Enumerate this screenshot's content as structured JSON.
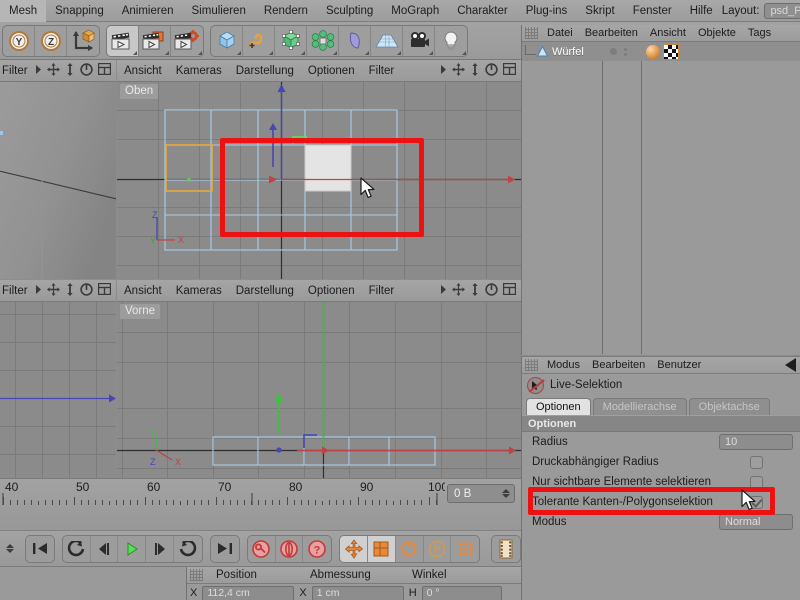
{
  "menubar": {
    "items": [
      "Mesh",
      "Snapping",
      "Animieren",
      "Simulieren",
      "Rendern",
      "Sculpting",
      "MoGraph",
      "Charakter",
      "Plug-ins",
      "Skript",
      "Fenster",
      "Hilfe"
    ],
    "layout_label": "Layout:",
    "layout_value": "psd_P"
  },
  "toolbar": {
    "groups": [
      {
        "name": "axis-group",
        "buttons": [
          {
            "icon": "axis-y-lock-icon",
            "label": "Y"
          },
          {
            "icon": "axis-z-lock-icon",
            "label": "Z"
          },
          {
            "icon": "world-object-axis-icon",
            "label": ""
          }
        ]
      },
      {
        "name": "render-group",
        "buttons": [
          {
            "icon": "render-view-icon",
            "label": ""
          },
          {
            "icon": "render-region-icon",
            "label": ""
          },
          {
            "icon": "render-settings-icon",
            "label": ""
          }
        ]
      },
      {
        "name": "object-group",
        "buttons": [
          {
            "icon": "cube-primitive-icon",
            "label": ""
          },
          {
            "icon": "spline-pen-icon",
            "label": ""
          },
          {
            "icon": "generator-nurbs-icon",
            "label": ""
          },
          {
            "icon": "mograph-array-icon",
            "label": ""
          },
          {
            "icon": "deformer-bend-icon",
            "label": ""
          },
          {
            "icon": "scene-floor-icon",
            "label": ""
          },
          {
            "icon": "camera-icon",
            "label": ""
          },
          {
            "icon": "light-bulb-icon",
            "label": ""
          }
        ]
      }
    ]
  },
  "objectmanager": {
    "menu": [
      "Datei",
      "Bearbeiten",
      "Ansicht",
      "Objekte",
      "Tags"
    ],
    "row": {
      "name": "Würfel",
      "icon": "cube-object-icon",
      "tag_icons": [
        "material-tag-icon",
        "texture-checker-tag-icon"
      ]
    }
  },
  "attributemanager": {
    "menu": [
      "Modus",
      "Bearbeiten",
      "Benutzer"
    ],
    "tool_name": "Live-Selektion",
    "tool_icon": "live-selection-icon",
    "tabs": [
      {
        "label": "Optionen",
        "active": true
      },
      {
        "label": "Modellierachse",
        "active": false
      },
      {
        "label": "Objektachse",
        "active": false
      }
    ],
    "section_title": "Optionen",
    "rows": [
      {
        "label": "Radius",
        "type": "field",
        "value": "10"
      },
      {
        "label": "Druckabhängiger Radius",
        "type": "checkbox",
        "checked": false
      },
      {
        "label": "Nur sichtbare Elemente selektieren",
        "type": "checkbox",
        "checked": false,
        "highlighted": true
      },
      {
        "label": "Tolerante Kanten-/Polygonselektion",
        "type": "checkbox",
        "checked": true
      },
      {
        "label": "Modus",
        "type": "field",
        "value": "Normal"
      }
    ]
  },
  "viewports": {
    "menu_items": [
      "Ansicht",
      "Kameras",
      "Darstellung",
      "Optionen",
      "Filter"
    ],
    "menu_icons": [
      "arrow-right-icon",
      "move-view-icon",
      "zoom-view-icon",
      "rotate-view-icon",
      "maximize-view-icon"
    ],
    "top_label": "Oben",
    "front_label": "Vorne",
    "axis_labels_top": [
      "Z",
      "Y",
      "X"
    ],
    "axis_labels_front": [
      "Y",
      "Z",
      "X"
    ]
  },
  "timeline": {
    "tick_labels": [
      "40",
      "50",
      "60",
      "70",
      "80",
      "90",
      "100"
    ],
    "current_frame": "0 B"
  },
  "transport": {
    "buttons": [
      {
        "icon": "go-to-start-icon"
      },
      {
        "icon": "previous-key-icon"
      },
      {
        "icon": "step-back-icon"
      },
      {
        "icon": "play-icon"
      },
      {
        "icon": "step-forward-icon"
      },
      {
        "icon": "next-key-icon"
      },
      {
        "icon": "go-to-end-icon"
      },
      {
        "icon": "record-key-icon"
      },
      {
        "icon": "autokey-icon"
      },
      {
        "icon": "key-selection-icon"
      },
      {
        "icon": "record-position-icon"
      },
      {
        "icon": "record-scale-icon"
      },
      {
        "icon": "record-rotation-icon"
      },
      {
        "icon": "record-parameter-icon"
      },
      {
        "icon": "record-pla-icon"
      },
      {
        "icon": "timeline-window-icon"
      }
    ]
  },
  "coordinates": {
    "headers": [
      "Position",
      "Abmessung",
      "Winkel"
    ],
    "rows": [
      {
        "axis1": "X",
        "value1": "112,4 cm",
        "axis2": "X",
        "value2": "1 cm",
        "axis3": "H",
        "value3": "0 °"
      }
    ]
  },
  "colors": {
    "annotation_red": "#ee1111",
    "selection_white": "#e4e4e4",
    "mesh_blue": "#9dc6e8",
    "axis_red": "#c14242",
    "axis_green": "#3fc03f",
    "axis_blue": "#4646b4",
    "selection_orange": "#e0a030",
    "panel_gray": "#9a9a9a"
  }
}
